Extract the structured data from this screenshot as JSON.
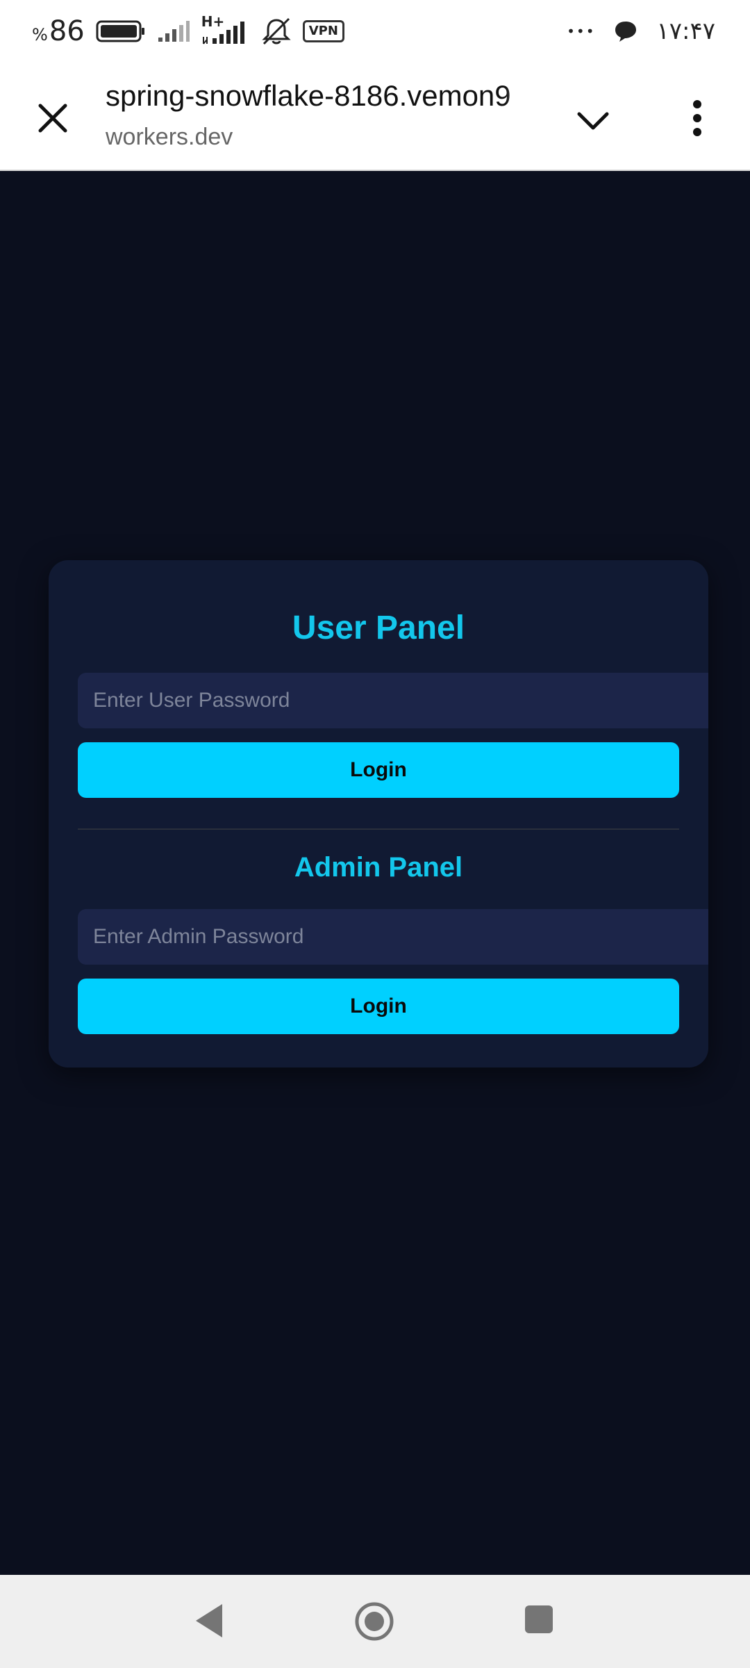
{
  "status_bar": {
    "battery_percent_sign": "%",
    "battery_percent_value": "86",
    "network_type": "H+",
    "vpn_label": "VPN",
    "more_dots": "•••",
    "time": "۱۷:۴۷"
  },
  "browser": {
    "page_title": "spring-snowflake-8186.vemon9",
    "domain": "workers.dev"
  },
  "user_panel": {
    "title": "User Panel",
    "password_placeholder": "Enter User Password",
    "login_label": "Login"
  },
  "admin_panel": {
    "title": "Admin Panel",
    "password_placeholder": "Enter Admin Password",
    "login_label": "Login"
  },
  "colors": {
    "page_background": "#0b0f1e",
    "card_background": "#111a33",
    "accent": "#13c7ec",
    "button": "#00d0ff",
    "input_background": "#1c2549"
  },
  "icons": {
    "close": "close-icon",
    "chevron": "chevron-down-icon",
    "menu": "more-vert-icon",
    "back": "nav-back-icon",
    "home": "nav-home-icon",
    "recents": "nav-recents-icon"
  }
}
